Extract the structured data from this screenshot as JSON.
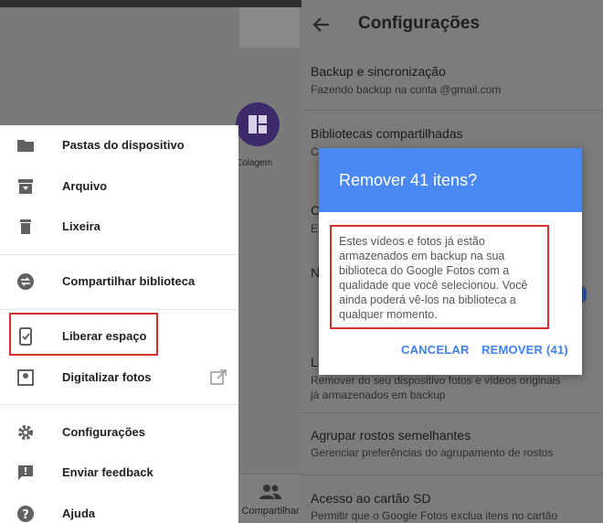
{
  "left": {
    "collage_label": "Colagem",
    "bottom_nav_label": "Compartilhar",
    "drawer": {
      "items": [
        {
          "label": "Pastas do dispositivo",
          "icon": "folder-icon"
        },
        {
          "label": "Arquivo",
          "icon": "archive-icon"
        },
        {
          "label": "Lixeira",
          "icon": "trash-icon"
        },
        {
          "label": "Compartilhar biblioteca",
          "icon": "share-library-icon"
        },
        {
          "label": "Liberar espaço",
          "icon": "free-space-icon"
        },
        {
          "label": "Digitalizar fotos",
          "icon": "scan-photos-icon"
        },
        {
          "label": "Configurações",
          "icon": "gear-icon"
        },
        {
          "label": "Enviar feedback",
          "icon": "feedback-icon"
        },
        {
          "label": "Ajuda",
          "icon": "help-icon"
        }
      ]
    }
  },
  "settings": {
    "title": "Configurações",
    "rows": [
      {
        "title": "Backup e sincronização",
        "subtitle": "Fazendo backup na conta            @gmail.com"
      },
      {
        "title": "Bibliotecas compartilhadas",
        "subtitle": "C"
      },
      {
        "title": "C",
        "subtitle": "E"
      },
      {
        "title": "N",
        "subtitle": ""
      },
      {
        "title": "L",
        "subtitle": "Remover do seu dispositivo fotos e vídeos originais",
        "subtitle2": "já armazenados em backup"
      },
      {
        "title": "Agrupar rostos semelhantes",
        "subtitle": "Gerenciar preferências do agrupamento de rostos"
      },
      {
        "title": "Acesso ao cartão SD",
        "subtitle": "Permitir que o Google Fotos exclua itens no cartão"
      }
    ]
  },
  "dialog": {
    "title": "Remover 41 itens?",
    "body": "Estes vídeos e fotos já estão armazenados em backup na sua biblioteca do Google Fotos com a qualidade que você selecionou. Você ainda poderá vê-los na biblioteca a qualquer momento.",
    "cancel_label": "CANCELAR",
    "confirm_label": "REMOVER (41)"
  },
  "colors": {
    "dialog_header": "#4a89f3",
    "button_text": "#3e82f0",
    "highlight": "#d32f2f",
    "toggle": "#2a55a0"
  }
}
